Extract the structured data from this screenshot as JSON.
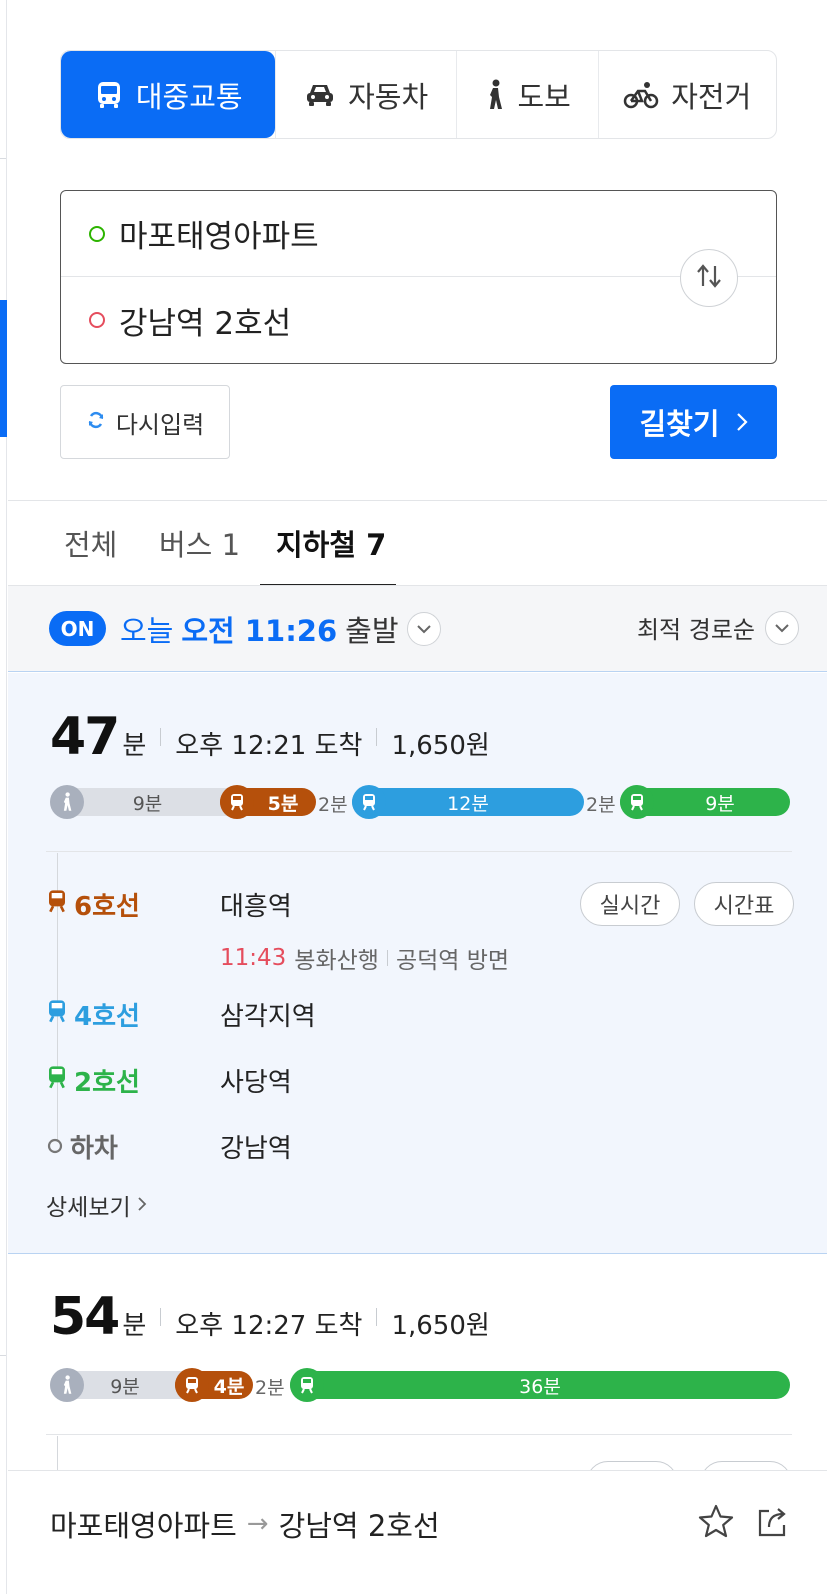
{
  "modes": [
    {
      "label": "대중교통",
      "icon": "bus-icon",
      "active": true
    },
    {
      "label": "자동차",
      "icon": "car-icon",
      "active": false
    },
    {
      "label": "도보",
      "icon": "walk-icon",
      "active": false
    },
    {
      "label": "자전거",
      "icon": "bicycle-icon",
      "active": false
    }
  ],
  "route": {
    "start": "마포태영아파트",
    "end": "강남역 2호선"
  },
  "buttons": {
    "reset": "다시입력",
    "search": "길찾기"
  },
  "result_tabs": [
    {
      "label": "전체",
      "active": false
    },
    {
      "label": "버스 1",
      "active": false
    },
    {
      "label": "지하철 7",
      "active": true
    }
  ],
  "departure": {
    "badge": "ON",
    "day": "오늘",
    "time": "오전 11:26",
    "suffix": "출발",
    "sort": "최적 경로순"
  },
  "colors": {
    "accent": "#0a6cf5",
    "line6": "#b5500b",
    "line4": "#2d9edf",
    "line2": "#2db34a",
    "walk": "#d8dbe2",
    "arrival_time": "#e54d5d"
  },
  "routes": [
    {
      "minutes": "47",
      "unit": "분",
      "arrive": "오후 12:21 도착",
      "fare": "1,650원",
      "segments": {
        "walk": "9분",
        "line6": "5분",
        "gap1": "2분",
        "line4": "12분",
        "gap2": "2분",
        "line2": "9분"
      },
      "steps": [
        {
          "line": "6호선",
          "station": "대흥역"
        },
        {
          "line": "4호선",
          "station": "삼각지역"
        },
        {
          "line": "2호선",
          "station": "사당역"
        },
        {
          "line": "하차",
          "station": "강남역"
        }
      ],
      "arrival": {
        "time": "11:43",
        "dest": "봉화산행",
        "direction": "공덕역 방면"
      },
      "pills": {
        "realtime": "실시간",
        "timetable": "시간표"
      },
      "detail": "상세보기"
    },
    {
      "minutes": "54",
      "unit": "분",
      "arrive": "오후 12:27 도착",
      "fare": "1,650원",
      "segments": {
        "walk": "9분",
        "line6": "4분",
        "gap1": "2분",
        "line2": "36분"
      }
    }
  ],
  "footer": {
    "start": "마포태영아파트",
    "arrow": "→",
    "end": "강남역 2호선"
  }
}
